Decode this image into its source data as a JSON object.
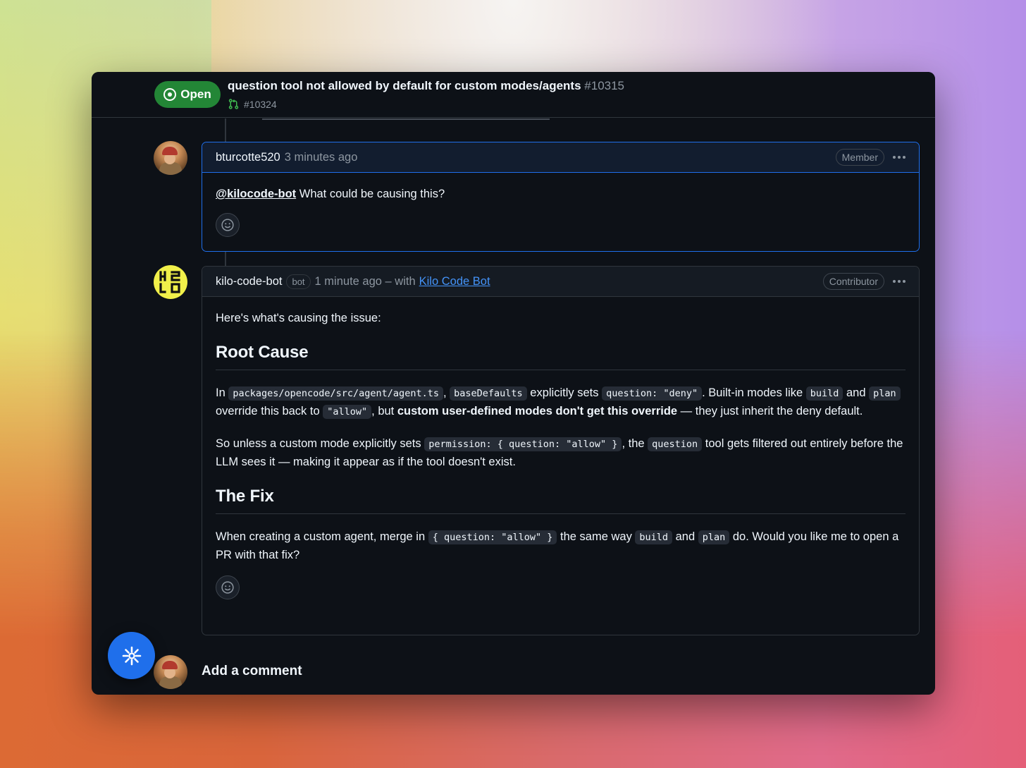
{
  "issue": {
    "state": "Open",
    "title": "question tool not allowed by default for custom modes/agents",
    "number": "#10315",
    "linked_pr": "#10324"
  },
  "comments": [
    {
      "author": "bturcotte520",
      "time": "3 minutes ago",
      "role": "Member",
      "mention": "@kilocode-bot",
      "text": " What could be causing this?"
    },
    {
      "author": "kilo-code-bot",
      "bot_label": "bot",
      "time": "1 minute ago – with",
      "via": "Kilo Code Bot",
      "role": "Contributor",
      "intro": "Here's what's causing the issue:",
      "heading_root": "Root Cause",
      "p1": {
        "t1": "In ",
        "c1": "packages/opencode/src/agent/agent.ts",
        "t2": ", ",
        "c2": "baseDefaults",
        "t3": " explicitly sets ",
        "c3": "question: \"deny\"",
        "t4": ". Built-in modes like ",
        "c4": "build",
        "t5": " and ",
        "c5": "plan",
        "t6": " override this back to ",
        "c6": "\"allow\"",
        "t7": ", but ",
        "b1": "custom user-defined modes don't get this override",
        "t8": " — they just inherit the deny default."
      },
      "p2": {
        "t1": "So unless a custom mode explicitly sets ",
        "c1": "permission: { question: \"allow\" }",
        "t2": ", the ",
        "c2": "question",
        "t3": " tool gets filtered out entirely before the LLM sees it — making it appear as if the tool doesn't exist."
      },
      "heading_fix": "The Fix",
      "p3": {
        "t1": "When creating a custom agent, merge in ",
        "c1": "{ question: \"allow\" }",
        "t2": " the same way ",
        "c2": "build",
        "t3": " and ",
        "c3": "plan",
        "t4": " do. Would you like me to open a PR with that fix?"
      }
    }
  ],
  "add_comment": "Add a comment",
  "icons": {
    "state": "issue-open-icon",
    "pr": "git-pull-request-icon",
    "emoji": "smiley-icon",
    "menu": "kebab-horizontal-icon",
    "fab": "sparkle-icon"
  },
  "colors": {
    "open": "#238636",
    "link": "#4493f8",
    "highlight": "#1f6feb",
    "bot_avatar": "#f1f04a"
  }
}
